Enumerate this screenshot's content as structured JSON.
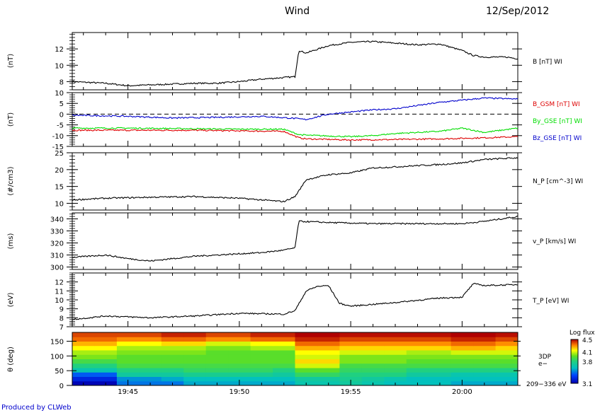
{
  "header": {
    "mission": "Wind",
    "date": "12/Sep/2012"
  },
  "footer": {
    "credit": "Produced by CLWeb"
  },
  "chart_data": [
    {
      "type": "line",
      "ylabel": "(nT)",
      "ylim": [
        7,
        14
      ],
      "yticks": [
        "8",
        "10",
        "12"
      ],
      "series": [
        {
          "name": "B [nT] WI",
          "color": "#000000",
          "x": [
            "19:42:30",
            "19:44",
            "19:45",
            "19:46",
            "19:47",
            "19:48",
            "19:49",
            "19:50",
            "19:51",
            "19:52",
            "19:52:30",
            "19:52:40",
            "19:53",
            "19:54",
            "19:55",
            "19:56",
            "19:57",
            "19:58",
            "19:59",
            "20:00",
            "20:00:30",
            "20:01",
            "20:02",
            "20:02:30"
          ],
          "values": [
            8.0,
            7.8,
            7.5,
            7.6,
            7.7,
            7.8,
            7.8,
            8.0,
            8.3,
            8.5,
            8.6,
            11.8,
            11.5,
            12.4,
            12.8,
            12.9,
            12.7,
            12.5,
            12.6,
            11.8,
            11.2,
            11.0,
            11.0,
            10.8
          ]
        }
      ]
    },
    {
      "type": "line",
      "ylabel": "(nT)",
      "ylim": [
        -15,
        10
      ],
      "yticks": [
        "-15",
        "-10",
        "-5",
        "0",
        "5",
        "10"
      ],
      "reference_line": 0,
      "series": [
        {
          "name": "B_GSM [nT] WI",
          "color": "#dd0000",
          "x": [
            "19:42:30",
            "19:45",
            "19:48",
            "19:50",
            "19:52",
            "19:52:40",
            "19:53",
            "19:55",
            "19:57",
            "19:59",
            "20:01",
            "20:02:30"
          ],
          "values": [
            -7.5,
            -7.5,
            -7.5,
            -7.8,
            -8.0,
            -11.0,
            -11.5,
            -12.0,
            -11.8,
            -11.5,
            -11.0,
            -10.5
          ]
        },
        {
          "name": "By_GSE [nT] WI",
          "color": "#00dd00",
          "x": [
            "19:42:30",
            "19:45",
            "19:48",
            "19:50",
            "19:52",
            "19:52:40",
            "19:53",
            "19:55",
            "19:56",
            "19:57",
            "19:58",
            "19:59",
            "20:00",
            "20:01",
            "20:02:30"
          ],
          "values": [
            -6.5,
            -6.5,
            -6.8,
            -7.0,
            -7.0,
            -9.5,
            -9.8,
            -10.5,
            -10.0,
            -9.0,
            -8.5,
            -8.0,
            -6.5,
            -8.5,
            -6.5
          ]
        },
        {
          "name": "Bz_GSE [nT] WI",
          "color": "#0000cc",
          "x": [
            "19:42:30",
            "19:45",
            "19:47",
            "19:49",
            "19:51",
            "19:52:30",
            "19:53",
            "19:54",
            "19:55",
            "19:56",
            "19:57",
            "19:58",
            "19:59",
            "20:00",
            "20:01",
            "20:02:30"
          ],
          "values": [
            -0.5,
            -1.0,
            -1.8,
            -1.5,
            -1.0,
            -2.0,
            -2.5,
            0.0,
            1.0,
            2.0,
            2.5,
            4.0,
            5.5,
            6.5,
            7.5,
            7.0
          ]
        }
      ]
    },
    {
      "type": "line",
      "ylabel": "(#/cm3)",
      "ylim": [
        8,
        25
      ],
      "yticks": [
        "10",
        "15",
        "20",
        "25"
      ],
      "series": [
        {
          "name": "N_P [cm^-3] WI",
          "color": "#000000",
          "x": [
            "19:42:30",
            "19:44",
            "19:46",
            "19:48",
            "19:50",
            "19:51",
            "19:52",
            "19:52:30",
            "19:53",
            "19:54",
            "19:55",
            "19:56",
            "19:57",
            "19:58",
            "19:59",
            "20:00",
            "20:01",
            "20:02:30"
          ],
          "values": [
            11.0,
            11.5,
            11.8,
            12.0,
            11.5,
            11.0,
            10.5,
            12.0,
            17.0,
            18.5,
            19.0,
            20.5,
            20.8,
            21.2,
            21.5,
            22.0,
            23.0,
            23.5
          ]
        }
      ]
    },
    {
      "type": "line",
      "ylabel": "(ms)",
      "ylim": [
        298,
        345
      ],
      "yticks": [
        "300",
        "310",
        "320",
        "330",
        "340"
      ],
      "series": [
        {
          "name": "v_P [km/s] WI",
          "color": "#000000",
          "x": [
            "19:42:30",
            "19:44",
            "19:45",
            "19:46",
            "19:47",
            "19:48",
            "19:49",
            "19:50",
            "19:51",
            "19:52",
            "19:52:30",
            "19:52:40",
            "19:54",
            "19:56",
            "19:58",
            "20:00",
            "20:01",
            "20:02:30"
          ],
          "values": [
            308,
            310,
            307,
            305,
            307,
            309,
            310,
            311,
            312,
            314,
            316,
            338,
            337,
            336,
            336,
            336,
            338,
            342
          ]
        }
      ]
    },
    {
      "type": "line",
      "ylabel": "(eV)",
      "ylim": [
        7,
        13
      ],
      "yticks": [
        "7",
        "8",
        "9",
        "10",
        "11",
        "12"
      ],
      "series": [
        {
          "name": "T_P [eV] WI",
          "color": "#000000",
          "x": [
            "19:42:30",
            "19:44",
            "19:46",
            "19:48",
            "19:50",
            "19:52",
            "19:52:30",
            "19:53",
            "19:53:30",
            "19:54",
            "19:54:30",
            "19:55",
            "19:57",
            "19:59",
            "20:00",
            "20:00:30",
            "20:01",
            "20:02:30"
          ],
          "values": [
            7.8,
            8.2,
            8.0,
            8.2,
            8.5,
            8.4,
            8.8,
            11.0,
            11.5,
            11.6,
            9.6,
            9.3,
            9.7,
            10.2,
            10.3,
            11.8,
            11.6,
            11.7
          ]
        }
      ]
    },
    {
      "type": "heatmap",
      "ylabel": "θ (deg)",
      "ylim": [
        0,
        180
      ],
      "yticks": [
        "0",
        "50",
        "100",
        "150"
      ],
      "xticks": [
        "19:45",
        "19:50",
        "19:55",
        "20:00"
      ],
      "xrange": [
        "19:42:30",
        "20:02:30"
      ],
      "instrument_label": [
        "3DP",
        "e−"
      ],
      "energy_label": "209−336 eV",
      "colorbar": {
        "title": "Log flux",
        "min": 3.1,
        "max": 4.5,
        "ticks": [
          "4.5",
          "4.1",
          "3.8",
          "3.1"
        ]
      },
      "theta_bins": [
        0,
        15,
        30,
        45,
        60,
        75,
        90,
        105,
        120,
        135,
        150,
        165,
        180
      ],
      "time_bins": [
        "19:42:30",
        "19:43:30",
        "19:44:30",
        "19:45:30",
        "19:46:30",
        "19:47:30",
        "19:48:30",
        "19:49:30",
        "19:50:30",
        "19:51:30",
        "19:52:30",
        "19:53:30",
        "19:54:30",
        "19:55:30",
        "19:56:30",
        "19:57:30",
        "19:58:30",
        "19:59:30",
        "20:00:30",
        "20:01:30",
        "20:02:30"
      ],
      "values": [
        [
          3.12,
          3.12,
          3.45,
          3.45,
          3.45,
          3.55,
          3.55,
          3.55,
          3.55,
          3.55,
          3.65,
          3.65,
          3.7,
          3.65,
          3.6,
          3.6,
          3.6,
          3.55,
          3.55,
          3.55
        ],
        [
          3.25,
          3.25,
          3.5,
          3.5,
          3.55,
          3.6,
          3.6,
          3.6,
          3.6,
          3.6,
          3.7,
          3.7,
          3.75,
          3.7,
          3.65,
          3.6,
          3.6,
          3.6,
          3.6,
          3.6
        ],
        [
          3.4,
          3.4,
          3.7,
          3.7,
          3.7,
          3.75,
          3.75,
          3.75,
          3.75,
          3.7,
          3.85,
          3.85,
          3.8,
          3.8,
          3.8,
          3.7,
          3.7,
          3.65,
          3.65,
          3.65
        ],
        [
          3.65,
          3.65,
          3.8,
          3.8,
          3.8,
          3.85,
          3.85,
          3.85,
          3.85,
          3.8,
          3.95,
          3.95,
          3.85,
          3.85,
          3.85,
          3.8,
          3.8,
          3.8,
          3.8,
          3.8
        ],
        [
          3.8,
          3.8,
          3.9,
          3.9,
          3.9,
          3.9,
          3.9,
          3.9,
          3.9,
          3.9,
          4.1,
          4.1,
          3.9,
          3.9,
          3.9,
          3.9,
          3.9,
          3.9,
          3.9,
          3.9
        ],
        [
          3.9,
          3.9,
          3.95,
          3.95,
          3.95,
          3.95,
          3.95,
          3.95,
          3.95,
          3.95,
          4.2,
          4.2,
          4.0,
          4.0,
          4.0,
          3.95,
          3.95,
          3.95,
          3.95,
          3.95
        ],
        [
          4.0,
          4.0,
          3.95,
          3.95,
          3.95,
          3.95,
          3.95,
          3.95,
          3.95,
          3.95,
          4.1,
          4.1,
          4.0,
          4.0,
          4.0,
          4.0,
          4.0,
          4.0,
          4.0,
          4.0
        ],
        [
          4.05,
          4.05,
          4.0,
          4.0,
          4.0,
          4.0,
          3.95,
          3.95,
          3.95,
          3.95,
          4.15,
          4.15,
          4.1,
          4.1,
          4.1,
          4.05,
          4.05,
          4.1,
          4.1,
          4.1
        ],
        [
          4.15,
          4.15,
          4.05,
          4.05,
          4.05,
          4.05,
          4.0,
          4.0,
          4.05,
          4.05,
          4.25,
          4.25,
          4.2,
          4.2,
          4.2,
          4.2,
          4.2,
          4.25,
          4.25,
          4.2
        ],
        [
          4.25,
          4.25,
          4.15,
          4.15,
          4.2,
          4.2,
          4.1,
          4.1,
          4.15,
          4.15,
          4.35,
          4.35,
          4.3,
          4.3,
          4.3,
          4.3,
          4.3,
          4.35,
          4.35,
          4.3
        ],
        [
          4.35,
          4.35,
          4.3,
          4.3,
          4.35,
          4.35,
          4.3,
          4.3,
          4.35,
          4.35,
          4.45,
          4.45,
          4.4,
          4.4,
          4.4,
          4.4,
          4.4,
          4.45,
          4.45,
          4.4
        ],
        [
          4.4,
          4.4,
          4.4,
          4.4,
          4.45,
          4.45,
          4.4,
          4.4,
          4.45,
          4.45,
          4.5,
          4.5,
          4.48,
          4.48,
          4.48,
          4.48,
          4.48,
          4.5,
          4.5,
          4.48
        ]
      ]
    }
  ]
}
